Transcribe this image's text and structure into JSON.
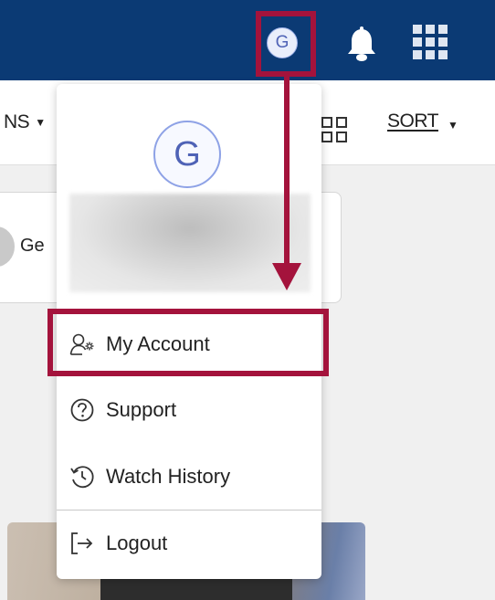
{
  "header": {
    "avatar_letter": "G",
    "icons": [
      "bell-icon",
      "apps-grid-icon"
    ],
    "bar_color": "#0b3a74"
  },
  "toolbar": {
    "filter_label_partial": "NS",
    "sort_label": "SORT",
    "icons": [
      "grid-view-icon",
      "chevron-down-icon"
    ]
  },
  "background": {
    "card_text_partial": "Ge"
  },
  "menu": {
    "avatar_letter": "G",
    "items": [
      {
        "label": "My Account",
        "icon": "user-settings-icon"
      },
      {
        "label": "Support",
        "icon": "help-circle-icon"
      },
      {
        "label": "Watch History",
        "icon": "history-icon"
      },
      {
        "label": "Logout",
        "icon": "logout-icon"
      }
    ]
  },
  "annotation": {
    "highlight_color": "#a4133c"
  }
}
